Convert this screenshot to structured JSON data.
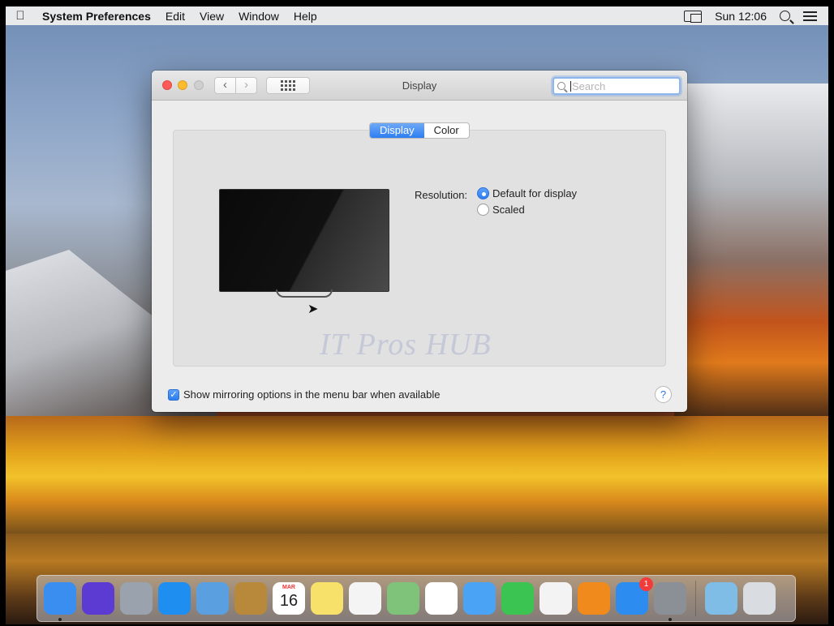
{
  "menubar": {
    "app_name": "System Preferences",
    "menus": [
      "Edit",
      "View",
      "Window",
      "Help"
    ],
    "clock": "Sun 12:06"
  },
  "window": {
    "title": "Display",
    "search_placeholder": "Search",
    "tabs": [
      {
        "label": "Display",
        "active": true
      },
      {
        "label": "Color",
        "active": false
      }
    ],
    "resolution_label": "Resolution:",
    "resolution_options": [
      {
        "label": "Default for display",
        "selected": true
      },
      {
        "label": "Scaled",
        "selected": false
      }
    ],
    "mirroring_label": "Show mirroring options in the menu bar when available",
    "mirroring_checked": true,
    "help_label": "?"
  },
  "watermark": "IT Pros HUB",
  "dock": {
    "items": [
      {
        "name": "finder",
        "color": "#3a8ef0",
        "running": true
      },
      {
        "name": "siri",
        "color": "#5b3bd1",
        "running": false
      },
      {
        "name": "launchpad",
        "color": "#9aa3ad",
        "running": false
      },
      {
        "name": "safari",
        "color": "#1f8ef1",
        "running": false
      },
      {
        "name": "mail",
        "color": "#5aa0e0",
        "running": false
      },
      {
        "name": "contacts",
        "color": "#b8893a",
        "running": false
      },
      {
        "name": "calendar",
        "color": "#ffffff",
        "running": false,
        "month": "MAR",
        "day": "16"
      },
      {
        "name": "notes",
        "color": "#f7e16b",
        "running": false
      },
      {
        "name": "reminders",
        "color": "#f4f4f4",
        "running": false
      },
      {
        "name": "maps",
        "color": "#7fc27a",
        "running": false
      },
      {
        "name": "photos",
        "color": "#ffffff",
        "running": false
      },
      {
        "name": "messages",
        "color": "#4aa3f5",
        "running": false
      },
      {
        "name": "facetime",
        "color": "#3bc452",
        "running": false
      },
      {
        "name": "itunes",
        "color": "#f3f3f3",
        "running": false
      },
      {
        "name": "ibooks",
        "color": "#f08a1c",
        "running": false
      },
      {
        "name": "app-store",
        "color": "#2d8cf0",
        "running": false,
        "badge": "1"
      },
      {
        "name": "system-preferences",
        "color": "#8b8f96",
        "running": true
      }
    ],
    "trailing": [
      {
        "name": "downloads",
        "color": "#7fbde6"
      },
      {
        "name": "trash",
        "color": "#d9dde2"
      }
    ]
  }
}
